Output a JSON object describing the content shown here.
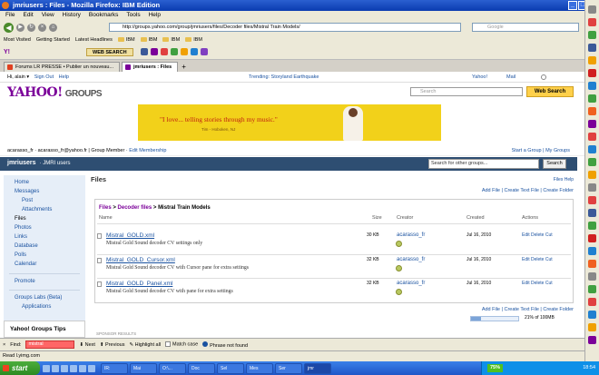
{
  "window": {
    "title": "jmriusers : Files - Mozilla Firefox: IBM Edition"
  },
  "menu": [
    "File",
    "Edit",
    "View",
    "History",
    "Bookmarks",
    "Tools",
    "Help"
  ],
  "nav": {
    "url": "http://groups.yahoo.com/group/jmriusers/files/Decoder files/Mistral Train Models/",
    "search_placeholder": "Google"
  },
  "bookmarks": [
    "Most Visited",
    "Getting Started",
    "Latest Headlines",
    "IBM",
    "IBM",
    "IBM",
    "IBM"
  ],
  "toolbar2": {
    "web_search": "WEB SEARCH"
  },
  "tabs": [
    {
      "label": "Forums LR PRESSE • Publier un nouveau..."
    },
    {
      "label": "jmriusers : Files"
    }
  ],
  "ytop": {
    "greeting": "Hi, alain ▾",
    "signout": "Sign Out",
    "help": "Help",
    "trending": "Trending: Storyland Earthquake",
    "yahoo": "Yahoo!",
    "mail": "Mail"
  },
  "yhead": {
    "logo": "YAHOO!",
    "groups": "GROUPS",
    "search_placeholder": "Search",
    "search_button": "Web Search"
  },
  "banner": {
    "quote": "\"I love... telling stories through my music.\"",
    "attribution": "Tim - Hoboken, NJ"
  },
  "account": {
    "ids": "acarasso_fr · acarasso_fr@yahoo.fr",
    "role": "Group Member",
    "edit": "Edit Membership",
    "start": "Start a Group",
    "my_groups": "My Groups"
  },
  "group": {
    "name": "jmriusers",
    "subtitle": "· JMRI users",
    "search_placeholder": "Search for other groups...",
    "search_button": "Search"
  },
  "sidebar": [
    {
      "label": "Home",
      "sub": false
    },
    {
      "label": "Messages",
      "sub": false
    },
    {
      "label": "Post",
      "sub": true
    },
    {
      "label": "Attachments",
      "sub": true
    },
    {
      "label": "Files",
      "sub": false,
      "current": true
    },
    {
      "label": "Photos",
      "sub": false
    },
    {
      "label": "Links",
      "sub": false
    },
    {
      "label": "Database",
      "sub": false
    },
    {
      "label": "Polls",
      "sub": false
    },
    {
      "label": "Calendar",
      "sub": false
    },
    {
      "label": "Promote",
      "sub": false
    },
    {
      "label": "Groups Labs (Beta)",
      "sub": false
    },
    {
      "label": "Applications",
      "sub": true
    }
  ],
  "tips_title": "Yahoo! Groups Tips",
  "files": {
    "title": "Files",
    "help": "Files Help",
    "actions": "Add File | Create Text File | Create Folder",
    "crumb_root": "Files",
    "crumb_mid": "Decoder files",
    "crumb_current": "Mistral Train Models",
    "columns": {
      "name": "Name",
      "size": "Size",
      "creator": "Creator",
      "created": "Created",
      "actions": "Actions"
    },
    "rows": [
      {
        "name": "Mistral_GOLD.xml",
        "desc": "Mistral Gold Sound decoder CV settings only",
        "size": "30 KB",
        "creator": "acarasso_fr",
        "created": "Jul 16, 2010",
        "actions": "Edit  Delete  Cut"
      },
      {
        "name": "Mistral_GOLD_Cursor.xml",
        "desc": "Mistral Gold Sound decoder CV with Cursor pane for extra settings",
        "size": "32 KB",
        "creator": "acarasso_fr",
        "created": "Jul 16, 2010",
        "actions": "Edit  Delete  Cut"
      },
      {
        "name": "Mistral_GOLD_Panel.xml",
        "desc": "Mistral Gold Sound decoder CV with pane for extra settings",
        "size": "32 KB",
        "creator": "acarasso_fr",
        "created": "Jul 16, 2010",
        "actions": "Edit  Delete  Cut"
      }
    ],
    "quota_text": "21% of 100MB",
    "quota_fraction": 0.21,
    "sponsor": "SPONSOR RESULTS"
  },
  "find": {
    "label": "Find:",
    "value": "mistral",
    "next": "Next",
    "previous": "Previous",
    "highlight": "Highlight all",
    "match_case": "Match case",
    "status": "Phrase not found"
  },
  "status": "Read l.yimg.com",
  "taskbar": {
    "start": "start",
    "tasks": [
      "IR:",
      "Mai",
      "O:\\...",
      "Doc",
      "Sel",
      "Mes",
      "Ser",
      "jmr"
    ],
    "battery": "75%",
    "clock": "18:54"
  },
  "colors": {
    "yahoo_purple": "#7b0099",
    "link_blue": "#1a52a0",
    "group_bar": "#2e4e72",
    "banner_yellow": "#f2d11a"
  }
}
